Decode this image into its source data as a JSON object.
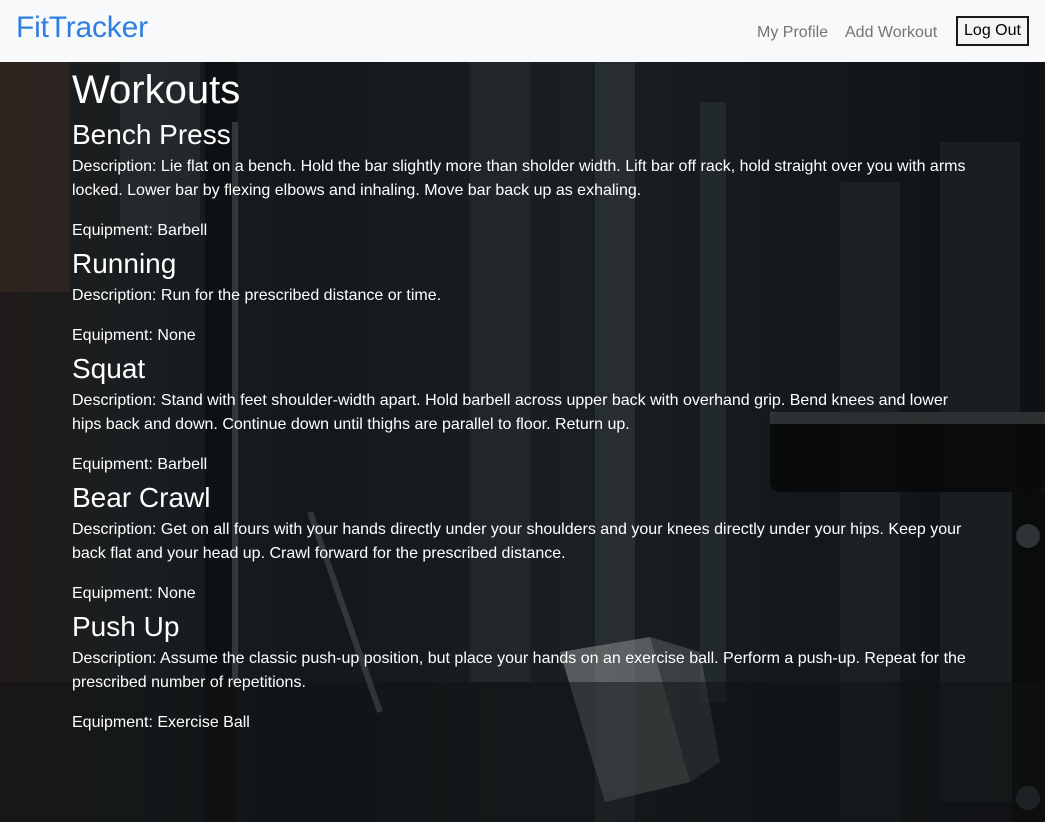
{
  "navbar": {
    "brand": "FitTracker",
    "links": [
      "My Profile",
      "Add Workout"
    ],
    "logout_label": "Log Out"
  },
  "page": {
    "title": "Workouts"
  },
  "workouts": [
    {
      "name": "Bench Press",
      "description": "Description: Lie flat on a bench. Hold the bar slightly more than sholder width. Lift bar off rack, hold straight over you with arms locked. Lower bar by flexing elbows and inhaling. Move bar back up as exhaling.",
      "equipment": "Equipment: Barbell"
    },
    {
      "name": "Running",
      "description": "Description: Run for the prescribed distance or time.",
      "equipment": "Equipment: None"
    },
    {
      "name": "Squat",
      "description": "Description: Stand with feet shoulder-width apart. Hold barbell across upper back with overhand grip. Bend knees and lower hips back and down. Continue down until thighs are parallel to floor. Return up.",
      "equipment": "Equipment: Barbell"
    },
    {
      "name": "Bear Crawl",
      "description": "Description: Get on all fours with your hands directly under your shoulders and your knees directly under your hips. Keep your back flat and your head up. Crawl forward for the prescribed distance.",
      "equipment": "Equipment: None"
    },
    {
      "name": "Push Up",
      "description": "Description: Assume the classic push-up position, but place your hands on an exercise ball. Perform a push-up. Repeat for the prescribed number of repetitions.",
      "equipment": "Equipment: Exercise Ball"
    }
  ],
  "colors": {
    "brand": "#2f7fe0",
    "navbar_bg": "#f8f9fa",
    "nav_link": "#757575",
    "text": "#ffffff"
  }
}
